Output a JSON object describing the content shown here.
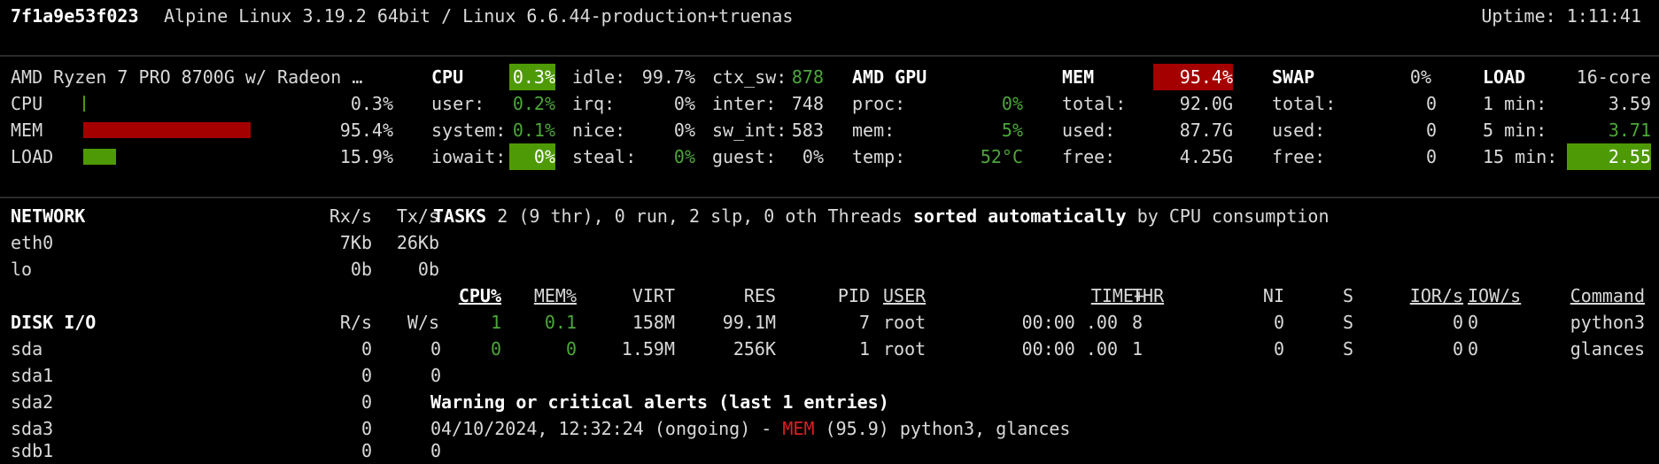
{
  "header": {
    "hostname": "7f1a9e53f023",
    "os": "Alpine Linux 3.19.2 64bit / Linux 6.6.44-production+truenas",
    "uptime": "Uptime: 1:11:41"
  },
  "quicklook": {
    "cpu_name": "AMD Ryzen 7 PRO 8700G w/ Radeon …",
    "rows": [
      {
        "label": "CPU",
        "value": "0.3%",
        "percent": 0.3
      },
      {
        "label": "MEM",
        "value": "95.4%",
        "percent": 95.4
      },
      {
        "label": "LOAD",
        "value": "15.9%",
        "percent": 15.9
      }
    ]
  },
  "cpu": {
    "title": "CPU",
    "total": "0.3%",
    "col1": [
      {
        "label": "user:",
        "value": "0.2%"
      },
      {
        "label": "system:",
        "value": "0.1%"
      },
      {
        "label": "iowait:",
        "value": "0%"
      }
    ],
    "col2": [
      {
        "label": "idle:",
        "value": "99.7%"
      },
      {
        "label": "irq:",
        "value": "0%"
      },
      {
        "label": "nice:",
        "value": "0%"
      },
      {
        "label": "steal:",
        "value": "0%"
      }
    ],
    "col3": [
      {
        "label": "ctx_sw:",
        "value": "878"
      },
      {
        "label": "inter:",
        "value": "748"
      },
      {
        "label": "sw_int:",
        "value": "583"
      },
      {
        "label": "guest:",
        "value": "0%"
      }
    ]
  },
  "gpu": {
    "title": "AMD GPU",
    "rows": [
      {
        "label": "proc:",
        "value": "0%"
      },
      {
        "label": "mem:",
        "value": "5%"
      },
      {
        "label": "temp:",
        "value": "52°C"
      }
    ]
  },
  "mem": {
    "title": "MEM",
    "percent": "95.4%",
    "rows": [
      {
        "label": "total:",
        "value": "92.0G"
      },
      {
        "label": "used:",
        "value": "87.7G"
      },
      {
        "label": "free:",
        "value": "4.25G"
      }
    ]
  },
  "swap": {
    "title": "SWAP",
    "percent": "0%",
    "rows": [
      {
        "label": "total:",
        "value": "0"
      },
      {
        "label": "used:",
        "value": "0"
      },
      {
        "label": "free:",
        "value": "0"
      }
    ]
  },
  "load": {
    "title": "LOAD",
    "cores": "16-core",
    "rows": [
      {
        "label": "1 min:",
        "value": "3.59"
      },
      {
        "label": "5 min:",
        "value": "3.71"
      },
      {
        "label": "15 min:",
        "value": "2.55"
      }
    ]
  },
  "network": {
    "title": "NETWORK",
    "rx_header": "Rx/s",
    "tx_header": "Tx/s",
    "rows": [
      {
        "name": "eth0",
        "rx": "7Kb",
        "tx": "26Kb"
      },
      {
        "name": "lo",
        "rx": "0b",
        "tx": "0b"
      }
    ]
  },
  "disk": {
    "title": "DISK I/O",
    "r_header": "R/s",
    "w_header": "W/s",
    "rows": [
      {
        "name": "sda",
        "r": "0",
        "w": "0"
      },
      {
        "name": "sda1",
        "r": "0",
        "w": "0"
      },
      {
        "name": "sda2",
        "r": "0",
        "w": "0"
      },
      {
        "name": "sda3",
        "r": "0",
        "w": "0"
      },
      {
        "name": "sdb1",
        "r": "0",
        "w": "0"
      }
    ]
  },
  "tasks": {
    "title": "TASKS",
    "summary": "2 (9 thr), 0 run, 2 slp, 0 oth Threads",
    "sorted_label": "sorted automatically",
    "sorted_suffix": "by CPU consumption"
  },
  "processes": {
    "headers": {
      "cpu": "CPU%",
      "mem": "MEM%",
      "virt": "VIRT",
      "res": "RES",
      "pid": "PID",
      "user": "USER",
      "time": "TIME+",
      "thr": "THR",
      "ni": "NI",
      "s": "S",
      "ior": "IOR/s",
      "iow": "IOW/s",
      "command": "Command"
    },
    "rows": [
      {
        "cpu": "1",
        "mem": "0.1",
        "virt": "158M",
        "res": "99.1M",
        "pid": "7",
        "user": "root",
        "time": "00:00 .00",
        "thr": "8",
        "ni": "0",
        "s": "S",
        "ior": "0",
        "iow": "0",
        "command": "python3"
      },
      {
        "cpu": "0",
        "mem": "0",
        "virt": "1.59M",
        "res": "256K",
        "pid": "1",
        "user": "root",
        "time": "00:00 .00",
        "thr": "1",
        "ni": "0",
        "s": "S",
        "ior": "0",
        "iow": "0",
        "command": "glances"
      }
    ]
  },
  "alerts": {
    "title": "Warning or critical alerts (last 1 entries)",
    "entry_time": "04/10/2024, 12:32:24 (ongoing) -",
    "entry_type": "MEM",
    "entry_detail": "(95.9) python3, glances"
  },
  "colors": {
    "ok": "#4ca63a",
    "critical": "#a40000",
    "highlight_green": "#4e9a06"
  }
}
